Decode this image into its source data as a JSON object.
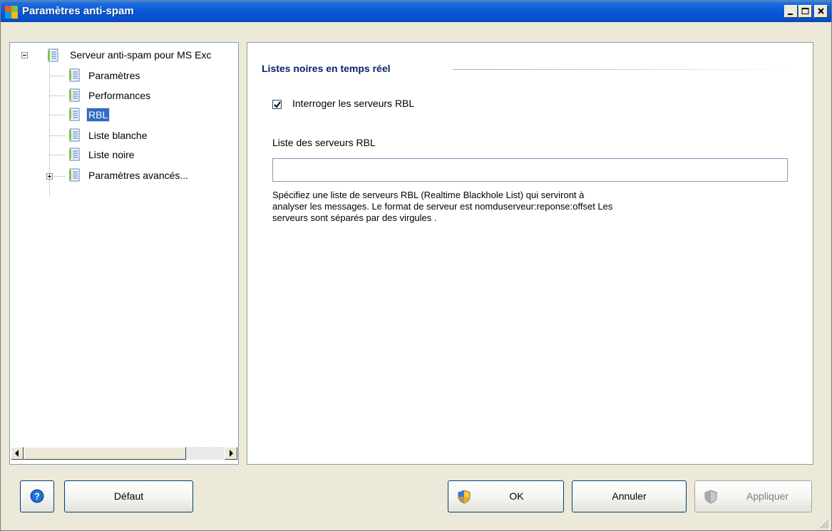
{
  "window": {
    "title": "Paramètres anti-spam"
  },
  "tree": {
    "root": {
      "label": "Serveur anti-spam pour MS Exc",
      "expanded": true
    },
    "items": [
      {
        "label": "Paramètres"
      },
      {
        "label": "Performances"
      },
      {
        "label": "RBL",
        "selected": true
      },
      {
        "label": "Liste blanche"
      },
      {
        "label": "Liste noire"
      },
      {
        "label": "Paramètres avancés...",
        "expandable": true
      }
    ]
  },
  "main": {
    "section_title": "Listes noires en temps réel",
    "query_rbl": {
      "label": "Interroger les serveurs RBL",
      "checked": true
    },
    "rbl_list": {
      "label": "Liste des serveurs RBL",
      "value": ""
    },
    "help_text": "Spécifiez une liste de serveurs RBL (Realtime Blackhole List) qui serviront à analyser les messages. Le format  de serveur est nomduserveur:reponse:offset Les serveurs sont séparés par des virgules ."
  },
  "buttons": {
    "help_icon": "help-icon",
    "defaut": "Défaut",
    "ok": "OK",
    "annuler": "Annuler",
    "appliquer": "Appliquer"
  },
  "colors": {
    "title_bar": "#0a58d6",
    "selection": "#316ac5",
    "section_title": "#0a246a"
  }
}
